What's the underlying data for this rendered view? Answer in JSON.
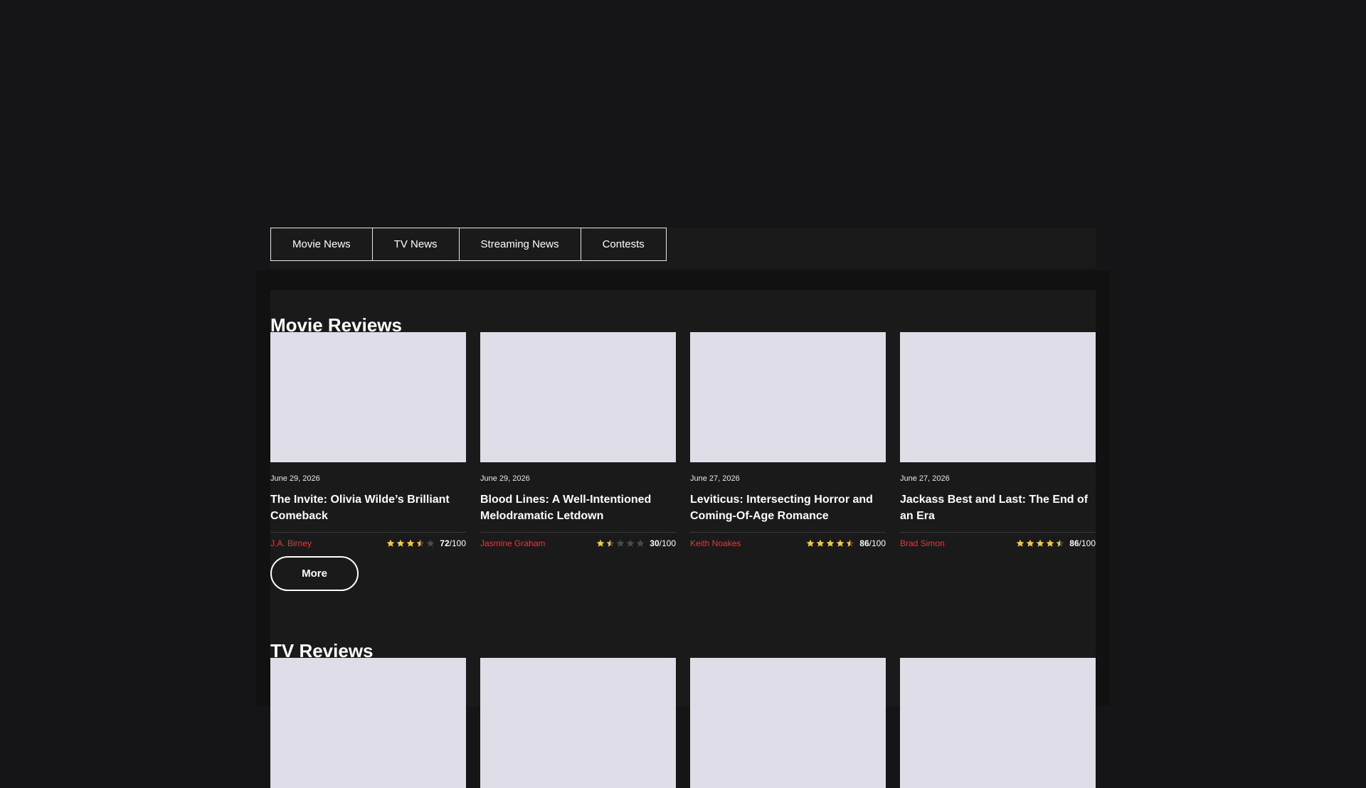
{
  "nav": {
    "items": [
      "Movie News",
      "TV News",
      "Streaming News",
      "Contests"
    ]
  },
  "movie_reviews": {
    "title": "Movie Reviews",
    "more_label": "More",
    "cards": [
      {
        "date": "June 29, 2026",
        "title": "The Invite: Olivia Wilde’s Brilliant Comeback",
        "author": "J.A. Birney",
        "stars": 3.5,
        "score": "72",
        "out_of": "/100"
      },
      {
        "date": "June 29, 2026",
        "title": "Blood Lines: A Well-Intentioned Melodramatic Letdown",
        "author": "Jasmine Graham",
        "stars": 1.5,
        "score": "30",
        "out_of": "/100"
      },
      {
        "date": "June 27, 2026",
        "title": "Leviticus: Intersecting Horror and Coming-Of-Age Romance",
        "author": "Keith Noakes",
        "stars": 4.5,
        "score": "86",
        "out_of": "/100"
      },
      {
        "date": "June 27, 2026",
        "title": "Jackass Best and Last: The End of an Era",
        "author": "Brad Simon",
        "stars": 4.5,
        "score": "86",
        "out_of": "/100"
      }
    ]
  },
  "tv_reviews": {
    "title": "TV Reviews",
    "cards": [
      {},
      {},
      {},
      {}
    ]
  },
  "colors": {
    "background": "#151517",
    "panel": "#1a1a1b",
    "accent_author": "#e13a3a",
    "star_filled": "#f5c842",
    "star_empty": "#4a4a4c",
    "thumbnail": "#dedde8"
  },
  "icons": {
    "star": "star-icon"
  }
}
